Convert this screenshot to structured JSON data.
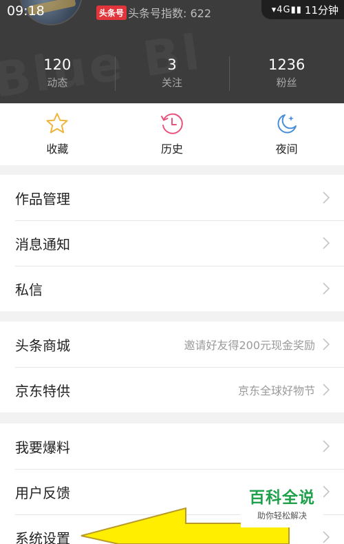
{
  "status_bar": {
    "time": "09:18",
    "network": "4G",
    "right_text": "11分钟"
  },
  "profile": {
    "badge": "头条号",
    "index_label": "头条号指数: 622"
  },
  "stats": [
    {
      "value": "120",
      "label": "动态"
    },
    {
      "value": "3",
      "label": "关注"
    },
    {
      "value": "1236",
      "label": "粉丝"
    }
  ],
  "quick_actions": [
    {
      "label": "收藏",
      "icon": "star-icon"
    },
    {
      "label": "历史",
      "icon": "clock-icon"
    },
    {
      "label": "夜间",
      "icon": "moon-icon"
    }
  ],
  "menu_group1": [
    "作品管理",
    "消息通知",
    "私信"
  ],
  "menu_group2": [
    {
      "label": "头条商城",
      "hint": "邀请好友得200元现金奖励"
    },
    {
      "label": "京东特供",
      "hint": "京东全球好物节"
    }
  ],
  "menu_group3": [
    "我要爆料",
    "用户反馈",
    "系统设置"
  ],
  "watermark": {
    "title": "百科全说",
    "subtitle": "助你轻松解决"
  },
  "colors": {
    "header_bg": "#3c3c3c",
    "accent_star": "#f0b43c",
    "accent_history": "#e8527a",
    "accent_moon": "#4a8ed8",
    "arrow_yellow": "#ffee00"
  }
}
